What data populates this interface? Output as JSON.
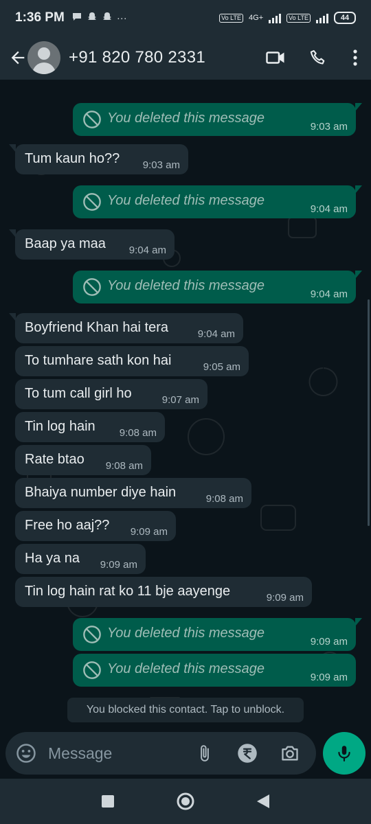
{
  "status_bar": {
    "time": "1:36 PM",
    "dots": "···",
    "net_label_1": "Vo LTE",
    "net_type": "4G+",
    "net_label_2": "Vo LTE",
    "battery": "44"
  },
  "header": {
    "contact": "+91 820 780 2331",
    "icons": [
      "back-arrow-icon",
      "avatar",
      "video-call-icon",
      "voice-call-icon",
      "more-options-icon"
    ]
  },
  "messages": [
    {
      "dir": "out",
      "deleted": true,
      "text": "You deleted this message",
      "time": "9:03 am"
    },
    {
      "dir": "in",
      "deleted": false,
      "text": "Tum kaun ho??",
      "time": "9:03 am"
    },
    {
      "dir": "out",
      "deleted": true,
      "text": "You deleted this message",
      "time": "9:04 am"
    },
    {
      "dir": "in",
      "deleted": false,
      "text": "Baap ya maa",
      "time": "9:04 am"
    },
    {
      "dir": "out",
      "deleted": true,
      "text": "You deleted this message",
      "time": "9:04 am"
    },
    {
      "dir": "in",
      "deleted": false,
      "text": "Boyfriend Khan hai tera",
      "time": "9:04 am"
    },
    {
      "dir": "in",
      "deleted": false,
      "text": "To tumhare sath kon hai",
      "time": "9:05 am"
    },
    {
      "dir": "in",
      "deleted": false,
      "text": "To tum call girl ho",
      "time": "9:07 am"
    },
    {
      "dir": "in",
      "deleted": false,
      "text": "Tin log hain",
      "time": "9:08 am"
    },
    {
      "dir": "in",
      "deleted": false,
      "text": "Rate btao",
      "time": "9:08 am"
    },
    {
      "dir": "in",
      "deleted": false,
      "text": "Bhaiya number diye hain",
      "time": "9:08 am"
    },
    {
      "dir": "in",
      "deleted": false,
      "text": "Free ho aaj??",
      "time": "9:09 am"
    },
    {
      "dir": "in",
      "deleted": false,
      "text": "Ha ya na",
      "time": "9:09 am"
    },
    {
      "dir": "in",
      "deleted": false,
      "text": "Tin log hain rat ko 11 bje aayenge",
      "time": "9:09 am"
    },
    {
      "dir": "out",
      "deleted": true,
      "text": "You deleted this message",
      "time": "9:09 am"
    },
    {
      "dir": "out",
      "deleted": true,
      "text": "You deleted this message",
      "time": "9:09 am"
    }
  ],
  "system_notice": "You blocked this contact. Tap to unblock.",
  "composer": {
    "placeholder": "Message",
    "icons": [
      "emoji-icon",
      "attach-icon",
      "rupee-payment-icon",
      "camera-icon",
      "mic-icon"
    ]
  },
  "nav": {
    "icons": [
      "recents-square-icon",
      "home-circle-icon",
      "back-triangle-icon"
    ]
  },
  "colors": {
    "background": "#0b141a",
    "bar": "#1f2c34",
    "incoming": "#1f2c34",
    "outgoing": "#005c4b",
    "accent": "#00a884"
  }
}
